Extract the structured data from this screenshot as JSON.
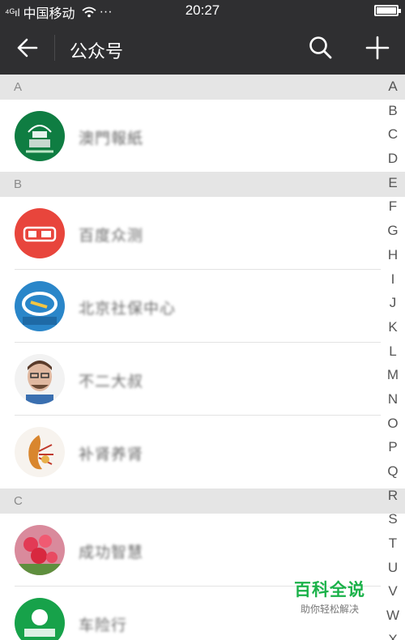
{
  "status_bar": {
    "signal": "⁴ᴳıl",
    "carrier": "中国移动",
    "more": "···",
    "time": "20:27",
    "battery_level": 0.9
  },
  "nav": {
    "title": "公众号",
    "back_icon": "arrow-left-icon",
    "search_icon": "search-icon",
    "add_icon": "plus-icon"
  },
  "sections": [
    {
      "letter": "A",
      "items": [
        {
          "name": "澳門報紙"
        }
      ]
    },
    {
      "letter": "B",
      "items": [
        {
          "name": "百度众测"
        },
        {
          "name": "北京社保中心"
        },
        {
          "name": "不二大叔"
        },
        {
          "name": "补肾养肾"
        }
      ]
    },
    {
      "letter": "C",
      "items": [
        {
          "name": "成功智慧"
        },
        {
          "name": "车险行"
        }
      ]
    }
  ],
  "index_letters": [
    "A",
    "B",
    "C",
    "D",
    "E",
    "F",
    "G",
    "H",
    "I",
    "J",
    "K",
    "L",
    "M",
    "N",
    "O",
    "P",
    "Q",
    "R",
    "S",
    "T",
    "U",
    "V",
    "W",
    "X"
  ],
  "watermark": {
    "logo": "百科全说",
    "sub": "助你轻松解决"
  },
  "colors": {
    "header_bg": "#2f2f31",
    "section_bg": "#e5e5e5",
    "accent": "#1bb24a"
  }
}
